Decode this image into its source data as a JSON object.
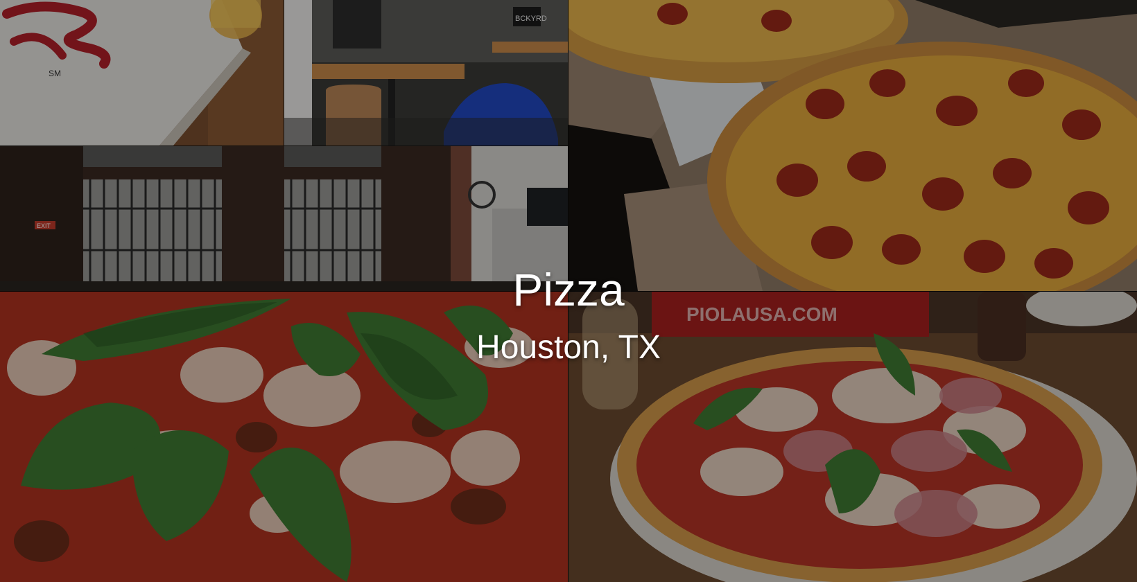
{
  "hero": {
    "title": "Pizza",
    "subtitle": "Houston, TX"
  },
  "photos": {
    "box_logo_text": "SM",
    "piola_banner_text": "PIOLAUSA.COM",
    "restaurant_sign_text": "BCKYRD",
    "exit_sign_text": "EXIT"
  },
  "colors": {
    "title_text": "#ffffff",
    "overlay": "rgba(0,0,0,0.36)",
    "tomato_sauce": "#b4301f",
    "basil": "#3f7a33",
    "cheese": "#e6b54a",
    "crust": "#c88b45",
    "banner_red": "#a8201e"
  }
}
